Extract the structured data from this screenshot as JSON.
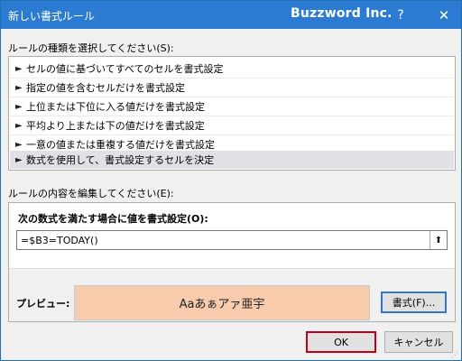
{
  "window": {
    "title": "新しい書式ルール",
    "brand": "Buzzword Inc.",
    "help_glyph": "?",
    "close_glyph": "✕"
  },
  "rule_type": {
    "label": "ルールの種類を選択してください(S):",
    "items": [
      {
        "label": "セルの値に基づいてすべてのセルを書式設定"
      },
      {
        "label": "指定の値を含むセルだけを書式設定"
      },
      {
        "label": "上位または下位に入る値だけを書式設定"
      },
      {
        "label": "平均より上または下の値だけを書式設定"
      },
      {
        "label": "一意の値または重複する値だけを書式設定"
      },
      {
        "label": "数式を使用して、書式設定するセルを決定"
      }
    ],
    "selected_index": 5,
    "bullet_icon": "triangle-right-icon"
  },
  "rule_content": {
    "label": "ルールの内容を編集してください(E):",
    "formula_label": "次の数式を満たす場合に値を書式設定(O):",
    "formula_value": "=$B3=TODAY()",
    "collapse_icon": "collapse-dialog-icon",
    "preview_label": "プレビュー:",
    "preview_text": "Aaあぁアァ亜宇",
    "preview_fill": "#f8cbad",
    "format_button": "書式(F)..."
  },
  "footer": {
    "ok_label": "OK",
    "cancel_label": "キャンセル"
  },
  "colors": {
    "titlebar": "#2b7bd3",
    "ok_highlight": "#c0001a"
  }
}
